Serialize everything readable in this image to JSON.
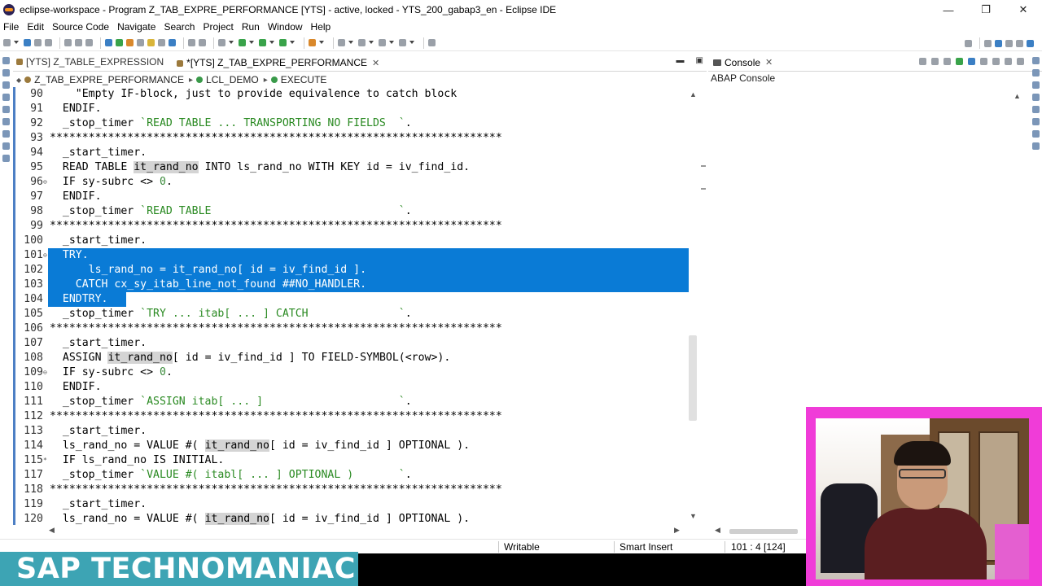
{
  "window": {
    "title": "eclipse-workspace - Program Z_TAB_EXPRE_PERFORMANCE [YTS]  - active, locked - YTS_200_gabap3_en - Eclipse IDE",
    "minimize": "—",
    "restore": "❐",
    "close": "✕"
  },
  "menu": {
    "items": [
      "File",
      "Edit",
      "Source Code",
      "Navigate",
      "Search",
      "Project",
      "Run",
      "Window",
      "Help"
    ]
  },
  "editor_tabs": [
    {
      "label": "[YTS] Z_TABLE_EXPRESSION",
      "active": false
    },
    {
      "label": "*[YTS] Z_TAB_EXPRE_PERFORMANCE",
      "active": true,
      "close": "✕"
    }
  ],
  "breadcrumb": {
    "items": [
      "Z_TAB_EXPRE_PERFORMANCE",
      "LCL_DEMO",
      "EXECUTE"
    ],
    "separator": "▸"
  },
  "code": {
    "lines": [
      {
        "n": "90",
        "fold": "",
        "text": "    \"Empty IF-block, just to provide equivalence to catch block"
      },
      {
        "n": "91",
        "fold": "",
        "text": "  ENDIF."
      },
      {
        "n": "92",
        "fold": "",
        "text": "  _stop_timer `READ TABLE ... TRANSPORTING NO FIELDS  `."
      },
      {
        "n": "93",
        "fold": "",
        "text": "**********************************************************************"
      },
      {
        "n": "94",
        "fold": "",
        "text": "  _start_timer."
      },
      {
        "n": "95",
        "fold": "",
        "text": "  READ TABLE it_rand_no INTO ls_rand_no WITH KEY id = iv_find_id."
      },
      {
        "n": "96",
        "fold": "⊖",
        "text": "  IF sy-subrc <> 0."
      },
      {
        "n": "97",
        "fold": "",
        "text": "  ENDIF."
      },
      {
        "n": "98",
        "fold": "",
        "text": "  _stop_timer `READ TABLE                             `."
      },
      {
        "n": "99",
        "fold": "",
        "text": "**********************************************************************"
      },
      {
        "n": "100",
        "fold": "",
        "text": "  _start_timer."
      },
      {
        "n": "101",
        "fold": "⊖",
        "text": "  TRY."
      },
      {
        "n": "102",
        "fold": "",
        "text": "      ls_rand_no = it_rand_no[ id = iv_find_id ]."
      },
      {
        "n": "103",
        "fold": "",
        "text": "    CATCH cx_sy_itab_line_not_found ##NO_HANDLER."
      },
      {
        "n": "104",
        "fold": "",
        "text": "  ENDTRY."
      },
      {
        "n": "105",
        "fold": "",
        "text": "  _stop_timer `TRY ... itab[ ... ] CATCH              `."
      },
      {
        "n": "106",
        "fold": "",
        "text": "**********************************************************************"
      },
      {
        "n": "107",
        "fold": "",
        "text": "  _start_timer."
      },
      {
        "n": "108",
        "fold": "",
        "text": "  ASSIGN it_rand_no[ id = iv_find_id ] TO FIELD-SYMBOL(<row>)."
      },
      {
        "n": "109",
        "fold": "⊖",
        "text": "  IF sy-subrc <> 0."
      },
      {
        "n": "110",
        "fold": "",
        "text": "  ENDIF."
      },
      {
        "n": "111",
        "fold": "",
        "text": "  _stop_timer `ASSIGN itab[ ... ]                     `."
      },
      {
        "n": "112",
        "fold": "",
        "text": "**********************************************************************"
      },
      {
        "n": "113",
        "fold": "",
        "text": "  _start_timer."
      },
      {
        "n": "114",
        "fold": "",
        "text": "  ls_rand_no = VALUE #( it_rand_no[ id = iv_find_id ] OPTIONAL )."
      },
      {
        "n": "115",
        "fold": "*",
        "text": "  IF ls_rand_no IS INITIAL."
      },
      {
        "n": "117",
        "fold": "",
        "text": "  _stop_timer `VALUE #( itabl[ ... ] OPTIONAL )       `."
      },
      {
        "n": "118",
        "fold": "",
        "text": "**********************************************************************"
      },
      {
        "n": "119",
        "fold": "",
        "text": "  _start_timer."
      },
      {
        "n": "120",
        "fold": "",
        "text": "  ls_rand_no = VALUE #( it_rand_no[ id = iv_find_id ] OPTIONAL )."
      }
    ],
    "selected_lines": [
      "101",
      "102",
      "103",
      "104"
    ]
  },
  "console": {
    "tab_label": "Console",
    "close": "✕",
    "title": "ABAP Console"
  },
  "statusbar": {
    "mode": "Writable",
    "insert": "Smart Insert",
    "position": "101 : 4 [124]"
  },
  "branding": {
    "text": "SAP TECHNOMANIAC"
  },
  "colors": {
    "selection": "#0a7bd6",
    "string": "#2a8a22",
    "brand_bg": "#3da4b4",
    "webcam_frame": "#f03cd8"
  }
}
